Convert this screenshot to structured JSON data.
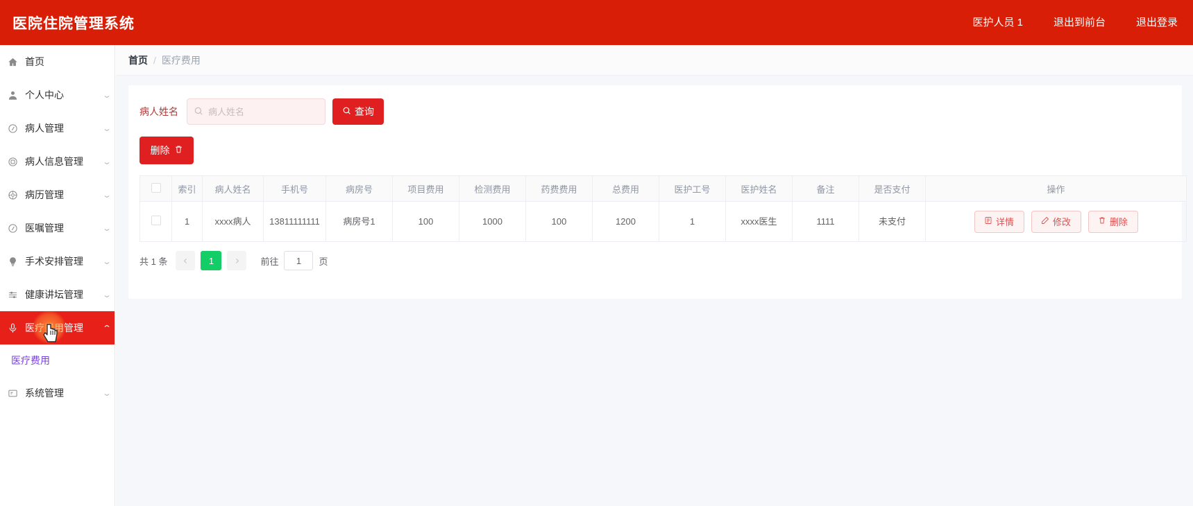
{
  "header": {
    "title": "医院住院管理系统",
    "links": [
      {
        "label": "医护人员 1",
        "name": "current-user"
      },
      {
        "label": "退出到前台",
        "name": "exit-to-frontend"
      },
      {
        "label": "退出登录",
        "name": "logout"
      }
    ]
  },
  "sidebar": {
    "items": [
      {
        "label": "首页",
        "icon": "home-icon",
        "expandable": false,
        "active": false
      },
      {
        "label": "个人中心",
        "icon": "user-icon",
        "expandable": true,
        "active": false
      },
      {
        "label": "病人管理",
        "icon": "clock-icon",
        "expandable": true,
        "active": false
      },
      {
        "label": "病人信息管理",
        "icon": "record-icon",
        "expandable": true,
        "active": false
      },
      {
        "label": "病历管理",
        "icon": "target-icon",
        "expandable": true,
        "active": false
      },
      {
        "label": "医嘱管理",
        "icon": "clock-icon",
        "expandable": true,
        "active": false
      },
      {
        "label": "手术安排管理",
        "icon": "bulb-icon",
        "expandable": true,
        "active": false
      },
      {
        "label": "健康讲坛管理",
        "icon": "sliders-icon",
        "expandable": true,
        "active": false
      },
      {
        "label": "医疗费用管理",
        "icon": "microphone-icon",
        "expandable": true,
        "active": true
      },
      {
        "label": "系统管理",
        "icon": "window-icon",
        "expandable": true,
        "active": false
      }
    ],
    "submenu": [
      {
        "label": "医疗费用",
        "parent": "医疗费用管理"
      }
    ]
  },
  "breadcrumb": {
    "home": "首页",
    "separator": "/",
    "current": "医疗费用"
  },
  "search": {
    "label": "病人姓名",
    "placeholder": "病人姓名",
    "value": "",
    "query_button": "查询",
    "query_icon": "search-icon"
  },
  "toolbar": {
    "delete_label": "删除",
    "delete_icon": "trash-icon"
  },
  "table": {
    "columns": [
      "索引",
      "病人姓名",
      "手机号",
      "病房号",
      "项目费用",
      "检测费用",
      "药费费用",
      "总费用",
      "医护工号",
      "医护姓名",
      "备注",
      "是否支付",
      "操作"
    ],
    "rows": [
      {
        "index": "1",
        "patient_name": "xxxx病人",
        "phone": "13811111111",
        "ward": "病房号1",
        "item_fee": "100",
        "test_fee": "1000",
        "drug_fee": "100",
        "total_fee": "1200",
        "staff_id": "1",
        "staff_name": "xxxx医生",
        "remark": "1111",
        "paid": "未支付"
      }
    ],
    "actions": [
      {
        "label": "详情",
        "icon": "detail-icon"
      },
      {
        "label": "修改",
        "icon": "edit-icon"
      },
      {
        "label": "删除",
        "icon": "trash-icon"
      }
    ]
  },
  "pagination": {
    "total_text": "共 1 条",
    "prev_icon": "chevron-left-icon",
    "next_icon": "chevron-right-icon",
    "current_page": "1",
    "jump_prefix": "前往",
    "jump_value": "1",
    "jump_suffix": "页"
  },
  "colors": {
    "brand_red": "#d81e06",
    "button_red": "#e02020",
    "active_page_green": "#13ce66",
    "submenu_purple": "#7b3fe4"
  }
}
